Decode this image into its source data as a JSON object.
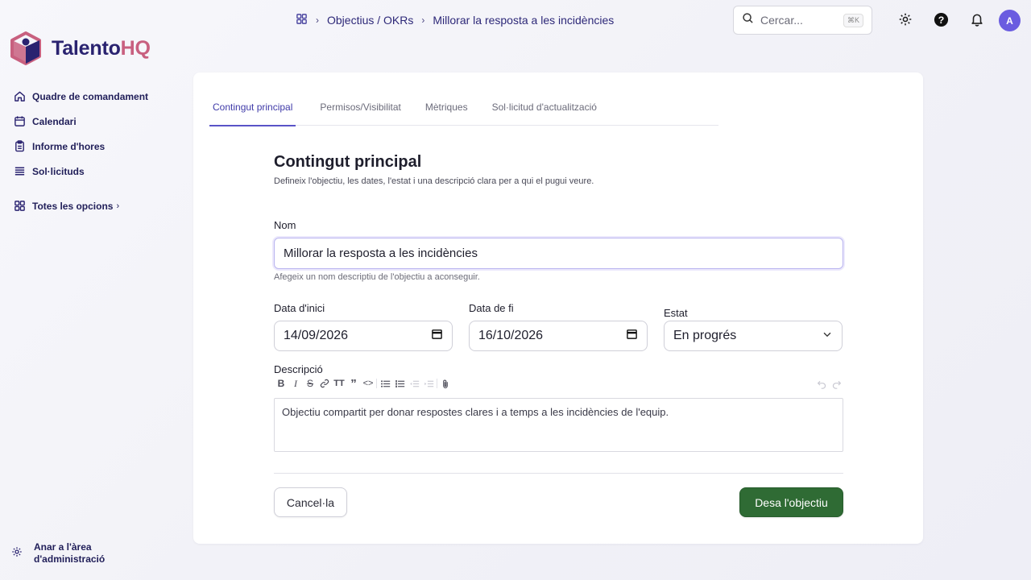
{
  "app": {
    "logo_text_main": "Talento",
    "logo_text_accent": "HQ",
    "brand_color": "#2a2370",
    "accent_color": "#c8607f",
    "primary_button_color": "#2f6b34"
  },
  "sidebar": {
    "items": [
      {
        "label": "Quadre de comandament",
        "icon": "home-icon"
      },
      {
        "label": "Calendari",
        "icon": "calendar-icon"
      },
      {
        "label": "Informe d'hores",
        "icon": "clipboard-icon"
      },
      {
        "label": "Sol·licituds",
        "icon": "list-icon"
      }
    ],
    "all_options": {
      "label": "Totes les opcions",
      "icon": "grid-icon",
      "chevron": "›"
    },
    "admin": {
      "label_line1": "Anar a l'àrea",
      "label_line2": "d'administració",
      "icon": "gear-icon"
    }
  },
  "header": {
    "breadcrumb": [
      "Objectius / OKRs",
      "Millorar la resposta a les incidències"
    ],
    "search": {
      "placeholder": "Cercar...",
      "shortcut": "⌘K"
    },
    "avatar_initial": "A"
  },
  "tabs": [
    {
      "label": "Contingut principal",
      "active": true
    },
    {
      "label": "Permisos/Visibilitat",
      "active": false
    },
    {
      "label": "Mètriques",
      "active": false
    },
    {
      "label": "Sol·licitud d'actualització",
      "active": false
    }
  ],
  "form": {
    "title": "Contingut principal",
    "description": "Defineix l'objectiu, les dates, l'estat i una descripció clara per a qui el pugui veure.",
    "name": {
      "label": "Nom",
      "value": "Millorar la resposta a les incidències",
      "hint": "Afegeix un nom descriptiu de l'objectiu a aconseguir."
    },
    "start_date": {
      "label": "Data d'inici",
      "value": "14/09/2026"
    },
    "end_date": {
      "label": "Data de fi",
      "value": "16/10/2026"
    },
    "status": {
      "label": "Estat",
      "value": "En progrés"
    },
    "body": {
      "label": "Descripció",
      "value": "Objectiu compartit per donar respostes clares i a temps a les incidències de l'equip."
    },
    "cancel_label": "Cancel·la",
    "save_label": "Desa l'objectiu"
  }
}
